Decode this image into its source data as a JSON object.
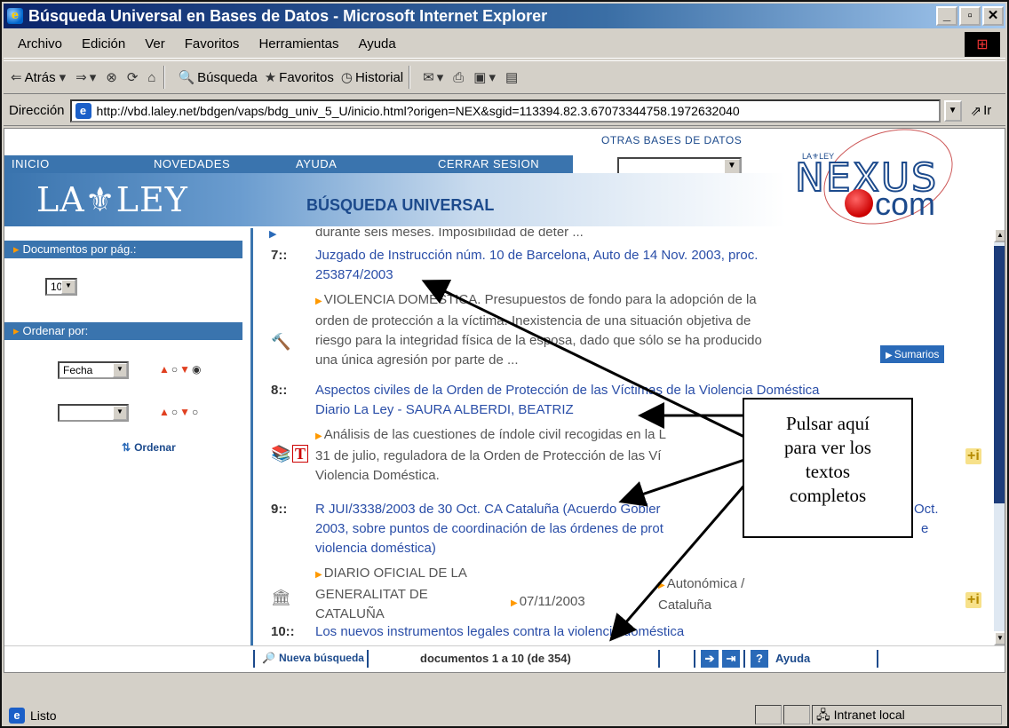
{
  "window": {
    "title": "Búsqueda Universal en Bases de Datos - Microsoft Internet Explorer",
    "minimize": "_",
    "maximize": "▫",
    "close": "✕"
  },
  "menu": [
    "Archivo",
    "Edición",
    "Ver",
    "Favoritos",
    "Herramientas",
    "Ayuda"
  ],
  "toolbar": {
    "back": "Atrás",
    "search": "Búsqueda",
    "favorites": "Favoritos",
    "history": "Historial"
  },
  "address": {
    "label": "Dirección",
    "url": "http://vbd.laley.net/bdgen/vaps/bdg_univ_5_U/inicio.html?origen=NEX&sgid=113394.82.3.67073344758.1972632040",
    "go": "Ir"
  },
  "site": {
    "nav": [
      "INICIO",
      "NOVEDADES",
      "AYUDA",
      "CERRAR SESION"
    ],
    "otras_bases": "OTRAS BASES DE DATOS",
    "logo_text": "LA⚜LEY",
    "page_title": "BÚSQUEDA UNIVERSAL",
    "nexus_small": "LA⚜LEY",
    "nexus_text": "NEXUS",
    "nexus_com": "com"
  },
  "left": {
    "docs_label": "Documentos por pág.:",
    "docs_value": "10",
    "sort_label": "Ordenar por:",
    "sort_value": "Fecha",
    "ordenar": "Ordenar"
  },
  "results": {
    "prev_tail": "durante seis meses. Imposibilidad de deter ...",
    "r7": {
      "num": "7::",
      "title1": "Juzgado de Instrucción núm. 10 de Barcelona, Auto de 14 Nov. 2003, proc.",
      "title2": "253874/2003",
      "d1": "VIOLENCIA DOMÉSTICA. Presupuestos de fondo para la adopción de la",
      "d2": "orden de protección a la víctima. Inexistencia de una situación objetiva de",
      "d3": "riesgo para la integridad física de la esposa, dado que sólo se ha producido",
      "d4": "una única agresión por parte de ...",
      "sumarios": "Sumarios"
    },
    "r8": {
      "num": "8::",
      "title1": "Aspectos civiles de la Orden de Protección de las Víctimas de la Violencia Doméstica",
      "title2": "Diario La Ley - SAURA ALBERDI, BEATRIZ",
      "d1": "Análisis de las cuestiones de índole civil recogidas en la L",
      "d2": "31 de julio, reguladora de la Orden de Protección de las Ví",
      "d3": "Violencia Doméstica."
    },
    "r9": {
      "num": "9::",
      "title1": "R JUI/3338/2003 de 30 Oct. CA Cataluña (Acuerdo Gobier",
      "title1b": "Oct.",
      "title2": "2003, sobre puntos de coordinación de las órdenes de prot",
      "title2b": "e",
      "title3": "violencia doméstica)",
      "src1": "DIARIO OFICIAL DE LA",
      "src2": "GENERALITAT DE",
      "src3": "CATALUÑA",
      "date": "07/11/2003",
      "scope1": "Autonómica /",
      "scope2": "Cataluña"
    },
    "r10": {
      "num": "10::",
      "title": "Los nuevos instrumentos legales contra la violencia doméstica"
    }
  },
  "footer": {
    "new_search": "Nueva búsqueda",
    "docs": "documentos 1 a 10 (de 354)",
    "help": "Ayuda"
  },
  "callout": {
    "l1": "Pulsar aquí",
    "l2": "para ver los",
    "l3": "textos",
    "l4": "completos"
  },
  "status": {
    "text": "Listo",
    "zone": "Intranet local"
  }
}
